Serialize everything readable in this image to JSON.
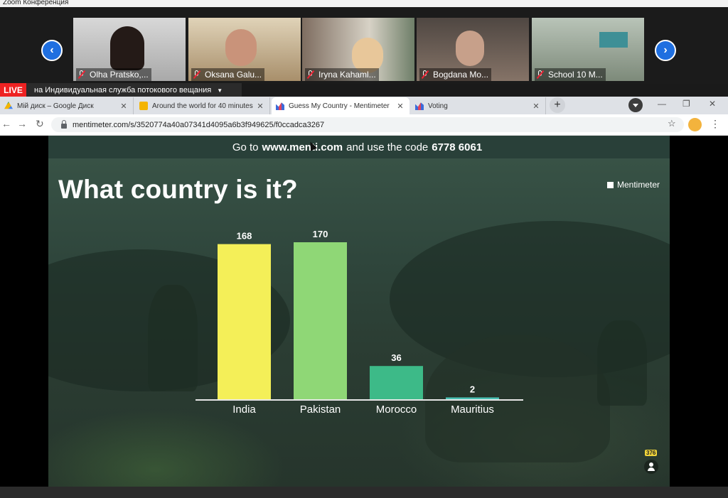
{
  "zoom": {
    "window_title": "Zoom Конференция",
    "participants": [
      {
        "name": "Olha Pratsko,...",
        "bg": "#bcbcbc"
      },
      {
        "name": "Oksana Galu...",
        "bg": "#c9b79a"
      },
      {
        "name": "Iryna Kahaml...",
        "bg": "#b8a89a"
      },
      {
        "name": "Bogdana Mo...",
        "bg": "#6b5f58"
      },
      {
        "name": "School 10 M...",
        "bg": "#9aa39a"
      }
    ],
    "live_label": "LIVE",
    "stream_label": "на Индивидуальная служба потокового вещания"
  },
  "browser": {
    "tabs": [
      {
        "title": "Мій диск – Google Диск",
        "color": "#1aa260"
      },
      {
        "title": "Around the world for 40 minutes",
        "color": "#f4b400"
      },
      {
        "title": "Guess My Country - Mentimeter",
        "color": "#3d6bd9"
      },
      {
        "title": "Voting",
        "color": "#3d6bd9"
      }
    ],
    "url": "mentimeter.com/s/3520774a40a07341d4095a6b3f949625/f0ccadca3267"
  },
  "slide": {
    "code_prefix": "Go to",
    "site": "www.menti.com",
    "code_mid": "and use the code",
    "code": "6778 6061",
    "question": "What country is it?",
    "brand": "Mentimeter",
    "response_count": "376"
  },
  "chart_data": {
    "type": "bar",
    "categories": [
      "India",
      "Pakistan",
      "Morocco",
      "Mauritius"
    ],
    "values": [
      168,
      170,
      36,
      2
    ],
    "colors": [
      "#f4ef58",
      "#8fd776",
      "#3dba88",
      "#4ac1b4"
    ],
    "title": "What country is it?",
    "xlabel": "",
    "ylabel": "",
    "ylim": [
      0,
      170
    ],
    "grid": false
  }
}
